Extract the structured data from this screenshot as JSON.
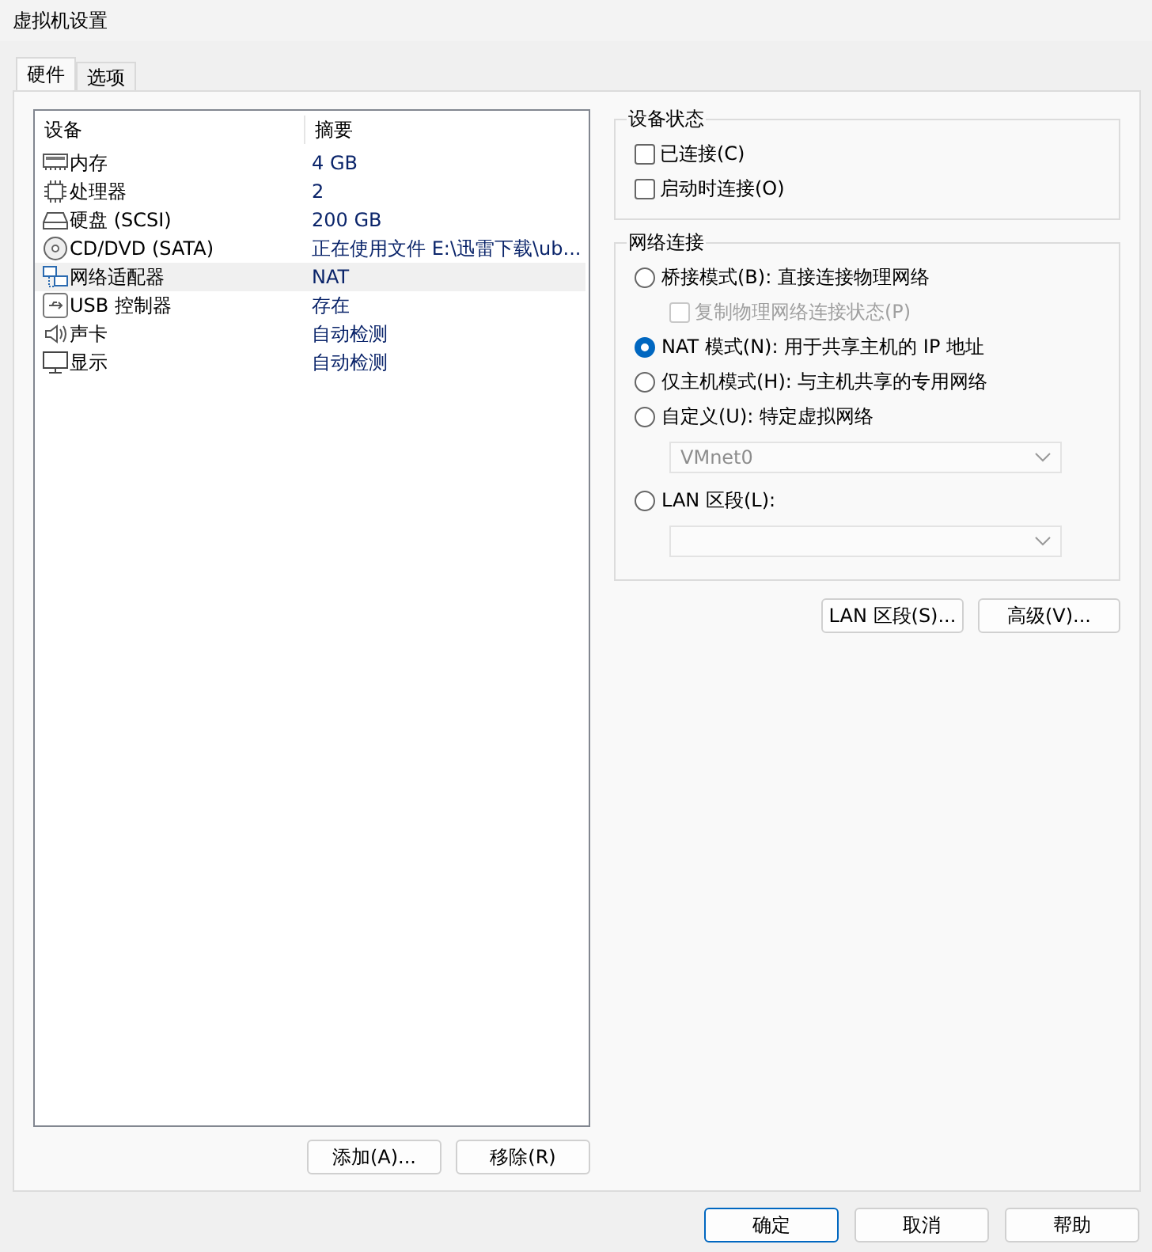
{
  "window": {
    "title": "虚拟机设置"
  },
  "tabs": [
    {
      "label": "硬件",
      "selected": true
    },
    {
      "label": "选项",
      "selected": false
    }
  ],
  "devices": {
    "columns": [
      "设备",
      "摘要"
    ],
    "rows": [
      {
        "kind": "memory",
        "name": "内存",
        "summary": "4 GB",
        "selected": false
      },
      {
        "kind": "cpu",
        "name": "处理器",
        "summary": "2",
        "selected": false
      },
      {
        "kind": "disk",
        "name": "硬盘 (SCSI)",
        "summary": "200 GB",
        "selected": false
      },
      {
        "kind": "cdrom",
        "name": "CD/DVD (SATA)",
        "summary": "正在使用文件 E:\\迅雷下载\\ub...",
        "selected": false
      },
      {
        "kind": "network",
        "name": "网络适配器",
        "summary": "NAT",
        "selected": true
      },
      {
        "kind": "usb",
        "name": "USB 控制器",
        "summary": "存在",
        "selected": false
      },
      {
        "kind": "sound",
        "name": "声卡",
        "summary": "自动检测",
        "selected": false
      },
      {
        "kind": "display",
        "name": "显示",
        "summary": "自动检测",
        "selected": false
      }
    ]
  },
  "list_buttons": [
    "添加(A)...",
    "移除(R)"
  ],
  "device_status": {
    "title": "设备状态",
    "options": [
      {
        "label": "已连接(C)",
        "checked": false
      },
      {
        "label": "启动时连接(O)",
        "checked": false
      }
    ]
  },
  "network_connection": {
    "title": "网络连接",
    "items": [
      {
        "kind": "radio",
        "label": "桥接模式(B): 直接连接物理网络",
        "selected": false
      },
      {
        "kind": "checkbox",
        "label": "复制物理网络连接状态(P)",
        "checked": false,
        "disabled": true
      },
      {
        "kind": "radio",
        "label": "NAT 模式(N): 用于共享主机的 IP 地址",
        "selected": true
      },
      {
        "kind": "radio",
        "label": "仅主机模式(H): 与主机共享的专用网络",
        "selected": false
      },
      {
        "kind": "radio",
        "label": "自定义(U): 特定虚拟网络",
        "selected": false
      },
      {
        "kind": "select",
        "value": "VMnet0",
        "disabled": true
      },
      {
        "kind": "radio",
        "label": "LAN 区段(L):",
        "selected": false
      },
      {
        "kind": "select",
        "disabled": true
      }
    ]
  },
  "network_buttons": [
    "LAN 区段(S)...",
    "高级(V)..."
  ],
  "dialog_buttons": [
    {
      "label": "确定",
      "default": true
    },
    {
      "label": "取消",
      "default": false
    },
    {
      "label": "帮助",
      "default": false
    }
  ]
}
